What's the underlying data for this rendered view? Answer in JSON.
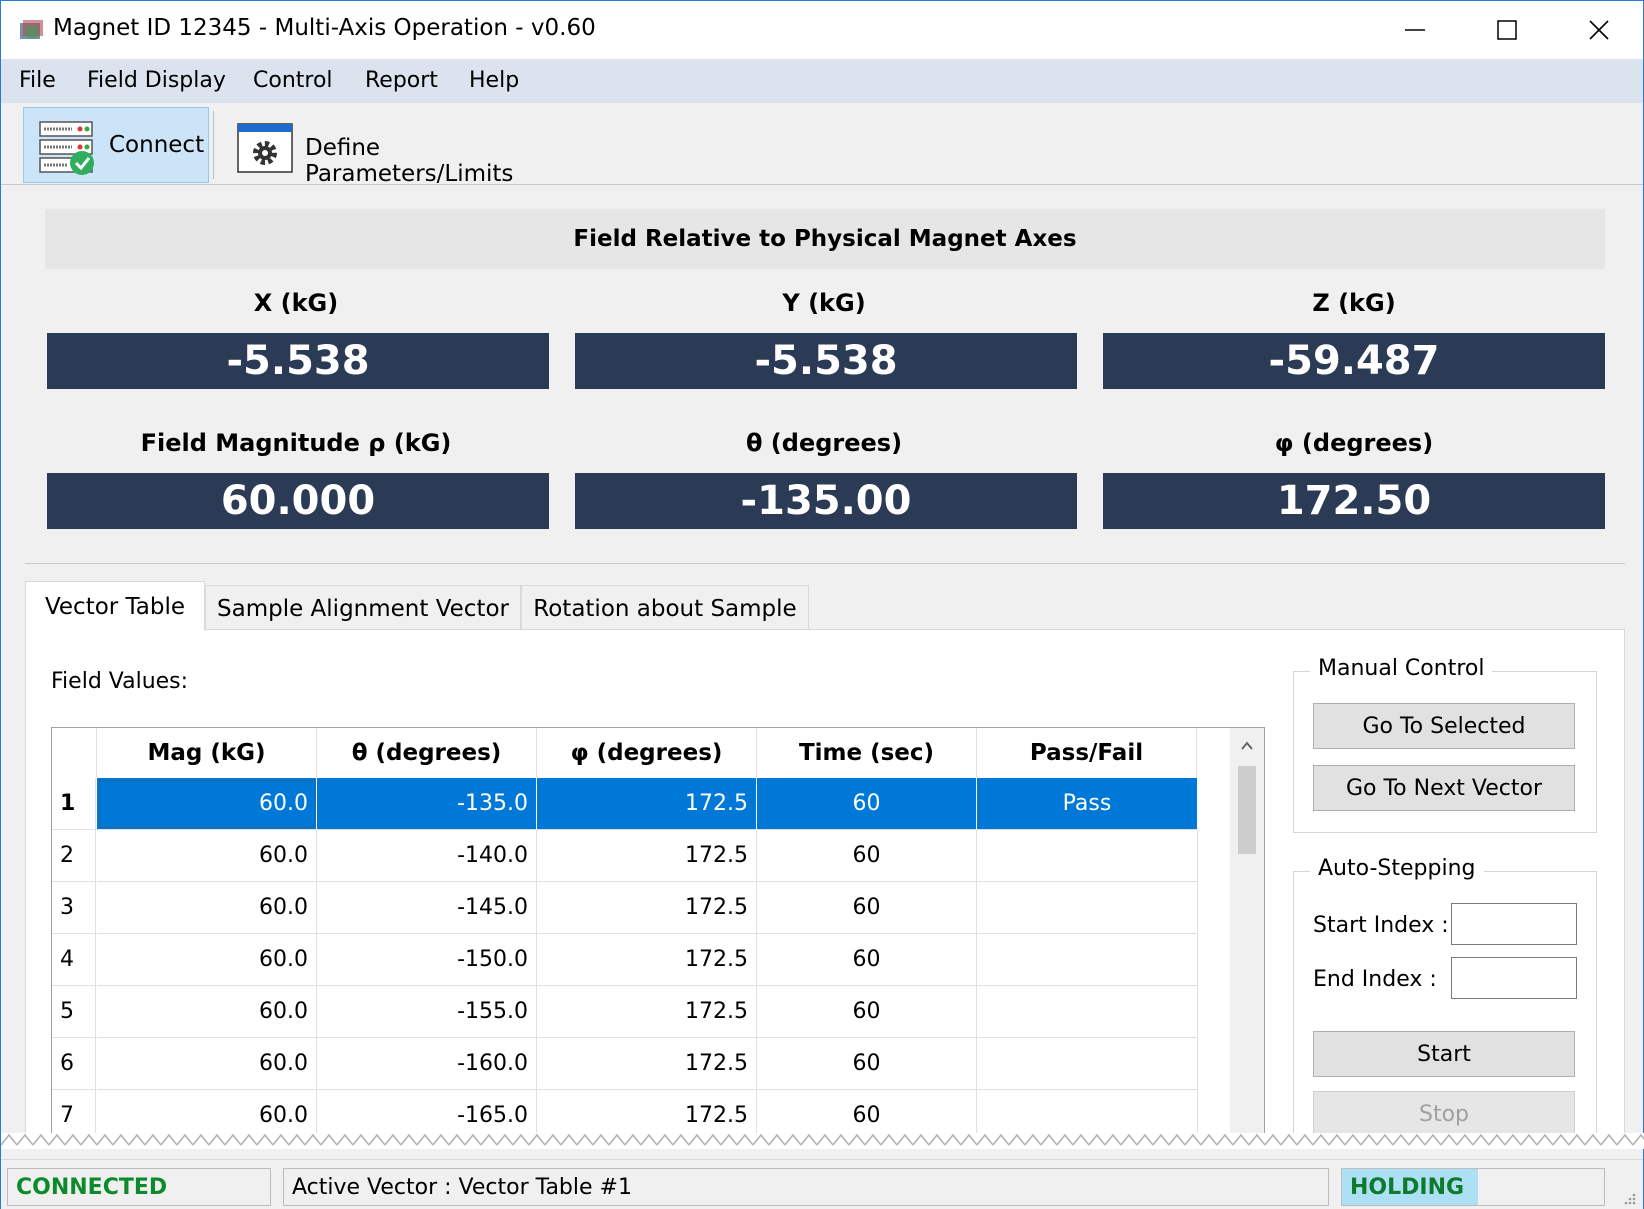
{
  "window": {
    "title": "Magnet ID 12345 - Multi-Axis Operation - v0.60",
    "minimize_glyph": "—",
    "maximize_glyph": "☐",
    "close_glyph": "✕"
  },
  "menu": [
    "File",
    "Field Display",
    "Control",
    "Report",
    "Help"
  ],
  "toolbar": {
    "connect_label": "Connect",
    "define_label": "Define Parameters/Limits",
    "connect_icon": "server-connected-icon",
    "define_icon": "gear-window-icon"
  },
  "field_panel": {
    "header": "Field Relative to Physical Magnet Axes",
    "readouts": [
      {
        "label": "X (kG)",
        "value": "-5.538"
      },
      {
        "label": "Y (kG)",
        "value": "-5.538"
      },
      {
        "label": "Z (kG)",
        "value": "-59.487"
      },
      {
        "label": "Field Magnitude ρ (kG)",
        "value": "60.000"
      },
      {
        "label": "θ (degrees)",
        "value": "-135.00"
      },
      {
        "label": "φ (degrees)",
        "value": "172.50"
      }
    ]
  },
  "tabs": [
    "Vector Table",
    "Sample Alignment Vector",
    "Rotation about Sample"
  ],
  "vector_table": {
    "section_label": "Field Values:",
    "columns": [
      "Mag (kG)",
      "θ (degrees)",
      "φ (degrees)",
      "Time (sec)",
      "Pass/Fail"
    ],
    "rows": [
      {
        "index": "1",
        "mag": "60.0",
        "theta": "-135.0",
        "phi": "172.5",
        "time": "60",
        "pass": "Pass"
      },
      {
        "index": "2",
        "mag": "60.0",
        "theta": "-140.0",
        "phi": "172.5",
        "time": "60",
        "pass": ""
      },
      {
        "index": "3",
        "mag": "60.0",
        "theta": "-145.0",
        "phi": "172.5",
        "time": "60",
        "pass": ""
      },
      {
        "index": "4",
        "mag": "60.0",
        "theta": "-150.0",
        "phi": "172.5",
        "time": "60",
        "pass": ""
      },
      {
        "index": "5",
        "mag": "60.0",
        "theta": "-155.0",
        "phi": "172.5",
        "time": "60",
        "pass": ""
      },
      {
        "index": "6",
        "mag": "60.0",
        "theta": "-160.0",
        "phi": "172.5",
        "time": "60",
        "pass": ""
      },
      {
        "index": "7",
        "mag": "60.0",
        "theta": "-165.0",
        "phi": "172.5",
        "time": "60",
        "pass": ""
      }
    ]
  },
  "manual_control": {
    "title": "Manual Control",
    "go_selected": "Go To Selected",
    "go_next": "Go To Next Vector"
  },
  "auto_stepping": {
    "title": "Auto-Stepping",
    "start_index_label": "Start Index :",
    "end_index_label": "End Index :",
    "start_index_value": "",
    "end_index_value": "",
    "start_button": "Start",
    "stop_button": "Stop"
  },
  "status": {
    "connection": "CONNECTED",
    "active_vector": "Active Vector : Vector Table #1",
    "state": "HOLDING"
  },
  "colors": {
    "readout_bg": "#2b3a55",
    "selection": "#0078d7",
    "connected_text": "#0d8a2c",
    "holding_bg": "#aee0f5"
  }
}
